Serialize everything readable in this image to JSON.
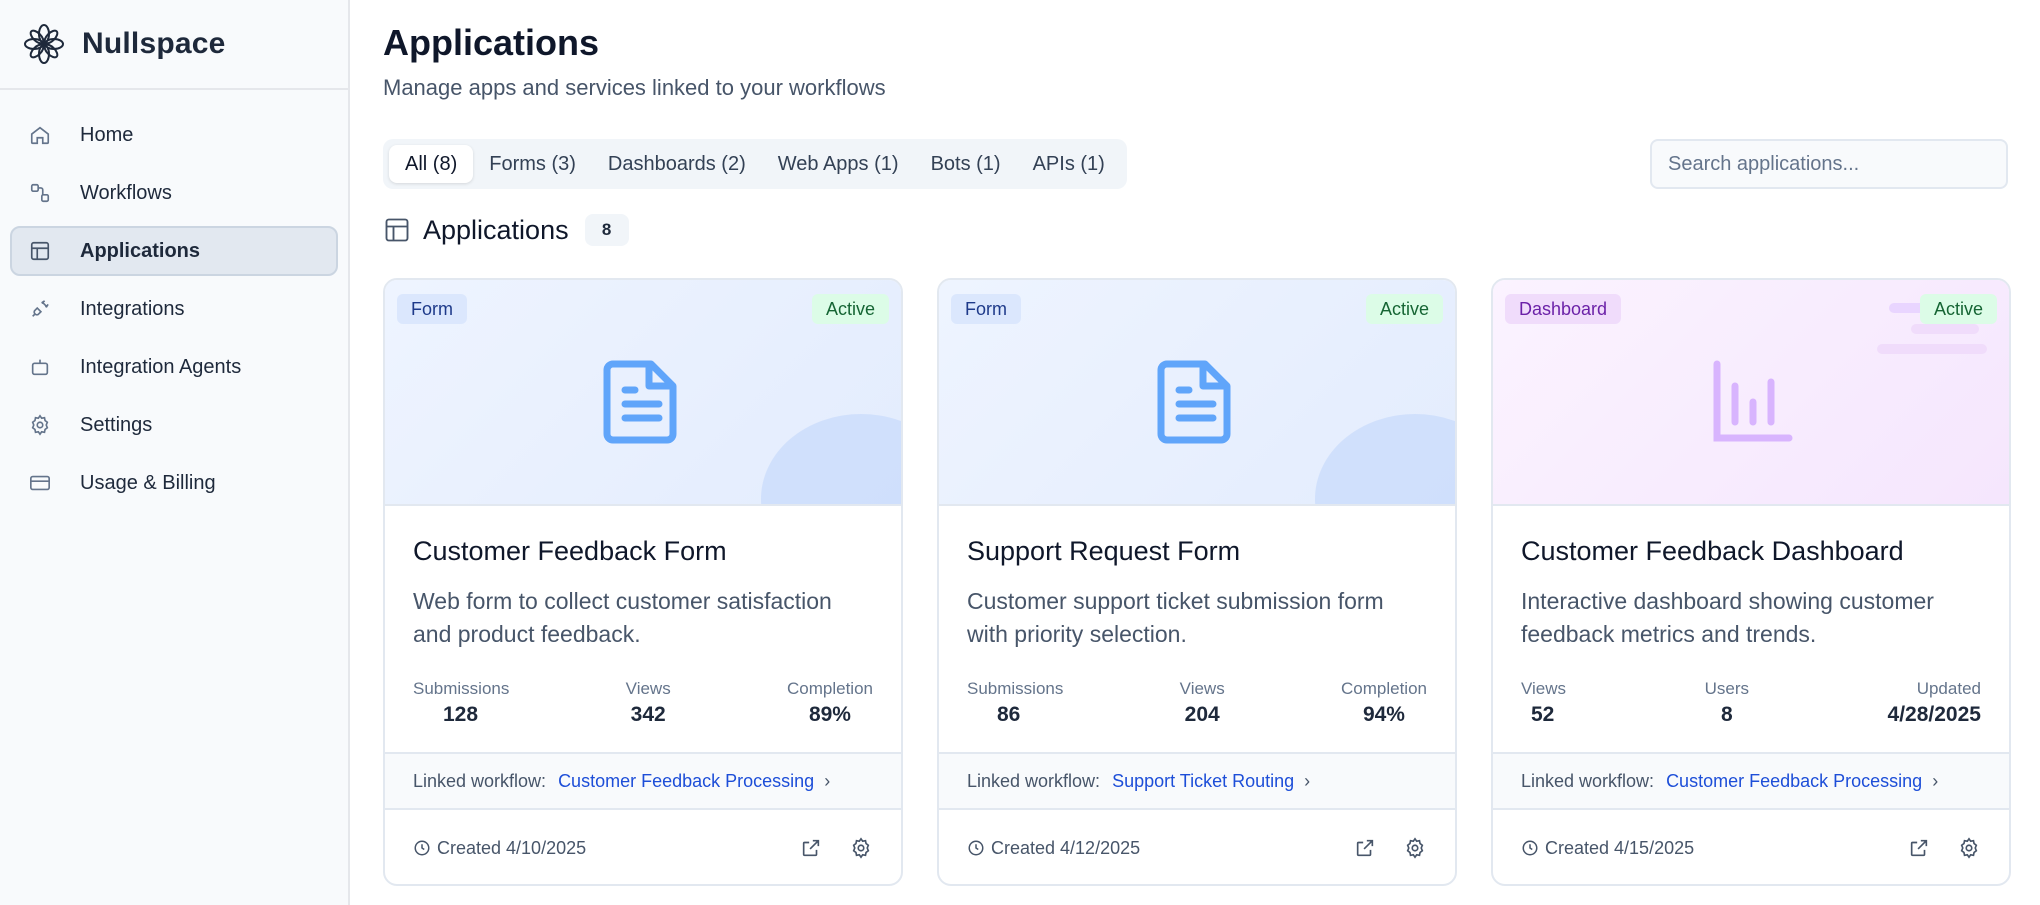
{
  "brand": {
    "name": "Nullspace",
    "logo_icon": "flower-logo-icon"
  },
  "sidebar": {
    "items": [
      {
        "label": "Home",
        "icon": "home-icon",
        "active": false
      },
      {
        "label": "Workflows",
        "icon": "workflow-icon",
        "active": false
      },
      {
        "label": "Applications",
        "icon": "layout-icon",
        "active": true
      },
      {
        "label": "Integrations",
        "icon": "plug-icon",
        "active": false
      },
      {
        "label": "Integration Agents",
        "icon": "bot-icon",
        "active": false
      },
      {
        "label": "Settings",
        "icon": "gear-icon",
        "active": false
      },
      {
        "label": "Usage & Billing",
        "icon": "credit-card-icon",
        "active": false
      }
    ]
  },
  "header": {
    "title": "Applications",
    "subtitle": "Manage apps and services linked to your workflows"
  },
  "tabs": [
    {
      "label": "All (8)",
      "active": true
    },
    {
      "label": "Forms (3)",
      "active": false
    },
    {
      "label": "Dashboards (2)",
      "active": false
    },
    {
      "label": "Web Apps (1)",
      "active": false
    },
    {
      "label": "Bots (1)",
      "active": false
    },
    {
      "label": "APIs (1)",
      "active": false
    }
  ],
  "search": {
    "placeholder": "Search applications...",
    "value": ""
  },
  "section": {
    "title": "Applications",
    "count": "8"
  },
  "cards": [
    {
      "type": "Form",
      "status": "Active",
      "title": "Customer Feedback Form",
      "description": "Web form to collect customer satisfaction and product feedback.",
      "stats": [
        {
          "label": "Submissions",
          "value": "128"
        },
        {
          "label": "Views",
          "value": "342"
        },
        {
          "label": "Completion",
          "value": "89%"
        }
      ],
      "workflow_label": "Linked workflow:",
      "workflow": "Customer Feedback Processing",
      "created": "Created 4/10/2025"
    },
    {
      "type": "Form",
      "status": "Active",
      "title": "Support Request Form",
      "description": "Customer support ticket submission form with priority selection.",
      "stats": [
        {
          "label": "Submissions",
          "value": "86"
        },
        {
          "label": "Views",
          "value": "204"
        },
        {
          "label": "Completion",
          "value": "94%"
        }
      ],
      "workflow_label": "Linked workflow:",
      "workflow": "Support Ticket Routing",
      "created": "Created 4/12/2025"
    },
    {
      "type": "Dashboard",
      "status": "Active",
      "title": "Customer Feedback Dashboard",
      "description": "Interactive dashboard showing customer feedback metrics and trends.",
      "stats": [
        {
          "label": "Views",
          "value": "52"
        },
        {
          "label": "Users",
          "value": "8"
        },
        {
          "label": "Updated",
          "value": "4/28/2025"
        }
      ],
      "workflow_label": "Linked workflow:",
      "workflow": "Customer Feedback Processing",
      "created": "Created 4/15/2025"
    }
  ],
  "colors": {
    "form_accent": "#60a5fa",
    "dashboard_accent": "#d8b4fe",
    "link": "#1d4ed8",
    "status_active": "#166534"
  }
}
